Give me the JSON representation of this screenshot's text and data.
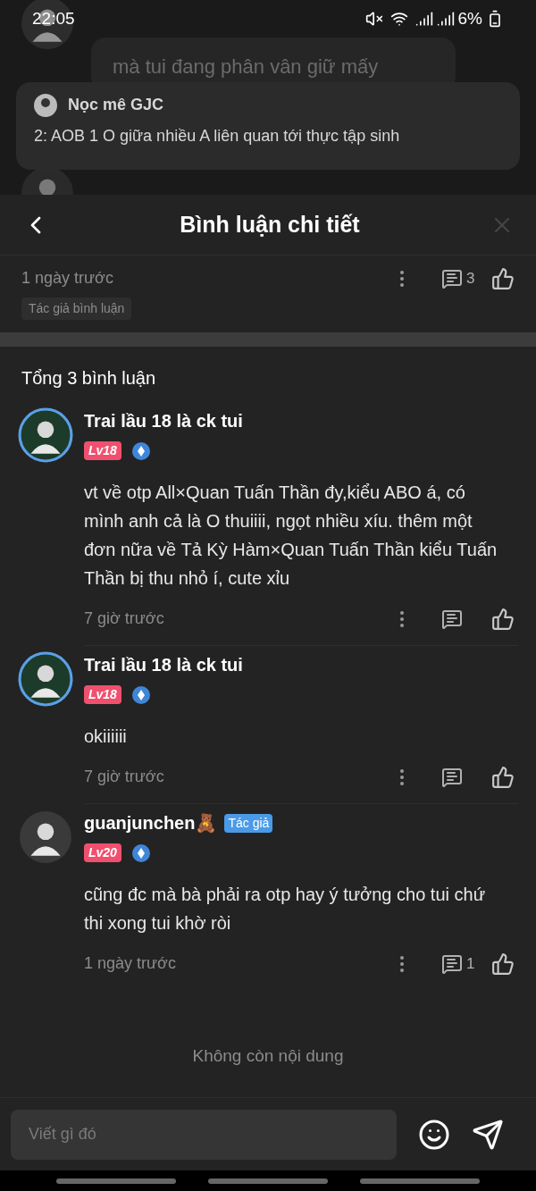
{
  "status_bar": {
    "time": "22:05",
    "battery": "6%"
  },
  "background": {
    "bubble_text": "mà tui đang phân vân giữ mấy",
    "popup": {
      "name": "Nọc mê GJC",
      "text": "2: AOB 1 O giữa nhiều A liên quan tới thực tập sinh"
    }
  },
  "sheet": {
    "title": "Bình luận chi tiết",
    "parent_comment": {
      "time": "1 ngày trước",
      "reply_count": "3",
      "tag": "Tác giả bình luận"
    },
    "total": "Tổng 3 bình luận",
    "comments": [
      {
        "name": "Trai lầu 18 là ck tui",
        "level": "Lv18",
        "text": "vt về otp All×Quan Tuấn Thần đy,kiểu ABO á, có mình anh cả là O thuiiii, ngọt nhiều xíu. thêm một đơn nữa về Tả Kỳ Hàm×Quan Tuấn Thần kiểu Tuấn Thần bị thu nhỏ í, cute xỉu",
        "time": "7 giờ trước"
      },
      {
        "name": "Trai lầu 18 là ck tui",
        "level": "Lv18",
        "text": "okiiiiii",
        "time": "7 giờ trước"
      },
      {
        "name": "guanjunchen🧸",
        "author_badge": "Tác giả",
        "level": "Lv20",
        "text": "cũng đc mà bà phải ra otp hay ý tưởng cho tui chứ thi xong tui khờ ròi",
        "time": "1 ngày trước",
        "reply_count": "1"
      }
    ],
    "end_text": "Không còn nội dung",
    "input": {
      "placeholder": "Viết gì đó"
    }
  }
}
